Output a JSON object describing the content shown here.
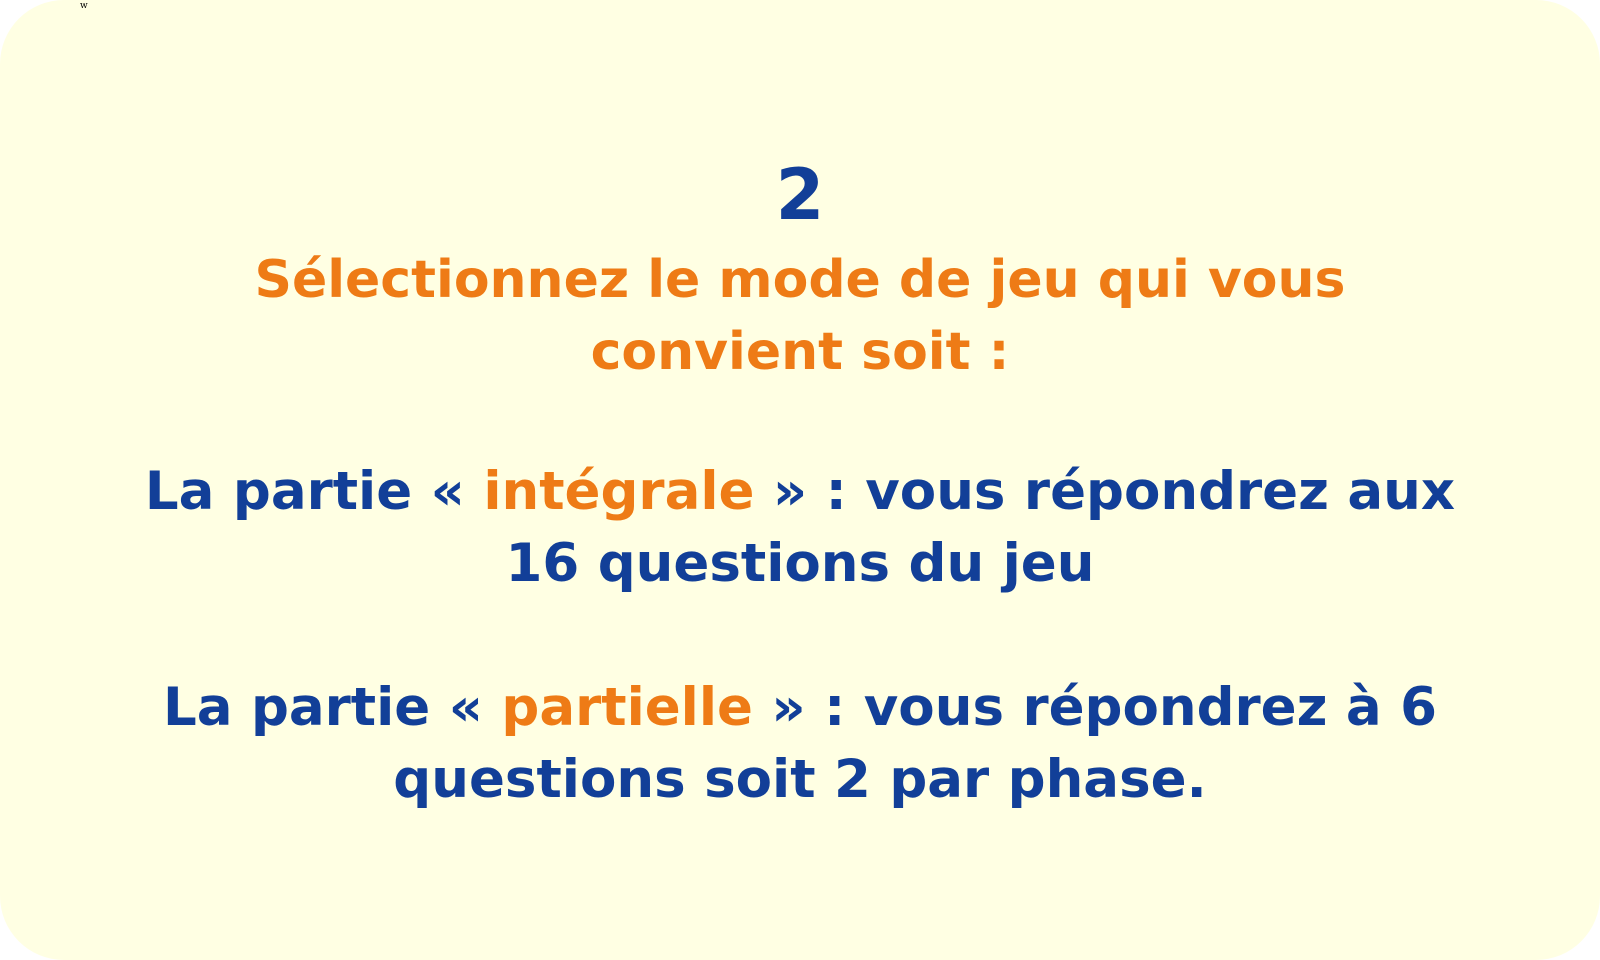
{
  "corner_mark": "w",
  "step_number": "2",
  "instruction": {
    "line1": "Sélectionnez le mode de jeu qui vous",
    "line2": "convient soit :"
  },
  "modes": [
    {
      "prefix": "La partie « ",
      "highlight": "intégrale",
      "suffix": " » : vous répondrez aux",
      "line2": "16 questions du jeu"
    },
    {
      "prefix": "La partie « ",
      "highlight": "partielle",
      "suffix": " » : vous répondrez à 6",
      "line2": "questions soit 2 par phase."
    }
  ],
  "colors": {
    "background": "#ffffe3",
    "blue": "#123f98",
    "orange": "#ee7b16"
  }
}
